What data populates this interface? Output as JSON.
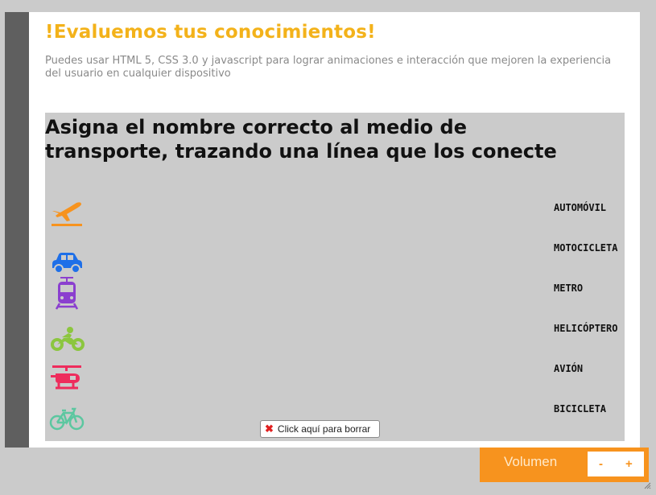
{
  "header": {
    "title": "!Evaluemos tus conocimientos!",
    "subtitle": "Puedes usar HTML 5, CSS 3.0 y javascript para lograr animaciones e interacción que mejoren la experiencia del usuario en cualquier dispositivo"
  },
  "activity": {
    "question": "Asigna el nombre correcto al medio de transporte, trazando una línea que los conecte",
    "icons": [
      {
        "icon": "airplane-icon",
        "color": "#f7931e"
      },
      {
        "icon": "car-icon",
        "color": "#1e6fe8"
      },
      {
        "icon": "tram-icon",
        "color": "#8b3fcf"
      },
      {
        "icon": "motorcycle-icon",
        "color": "#8cc63f"
      },
      {
        "icon": "helicopter-icon",
        "color": "#ee2c5c"
      },
      {
        "icon": "bicycle-icon",
        "color": "#5cc7a0"
      }
    ],
    "names": [
      "AUTOMÓVIL",
      "MOTOCICLETA",
      "METRO",
      "HELICÓPTERO",
      "AVIÓN",
      "BICICLETA"
    ],
    "clear_button": "Click aquí para borrar"
  },
  "volume": {
    "label": "Volumen",
    "minus": "-",
    "plus": "+"
  },
  "colors": {
    "title": "#f3b21a",
    "accent": "#f7931e",
    "panel": "#cbcbcb",
    "sidebar": "#5f5f5f"
  }
}
